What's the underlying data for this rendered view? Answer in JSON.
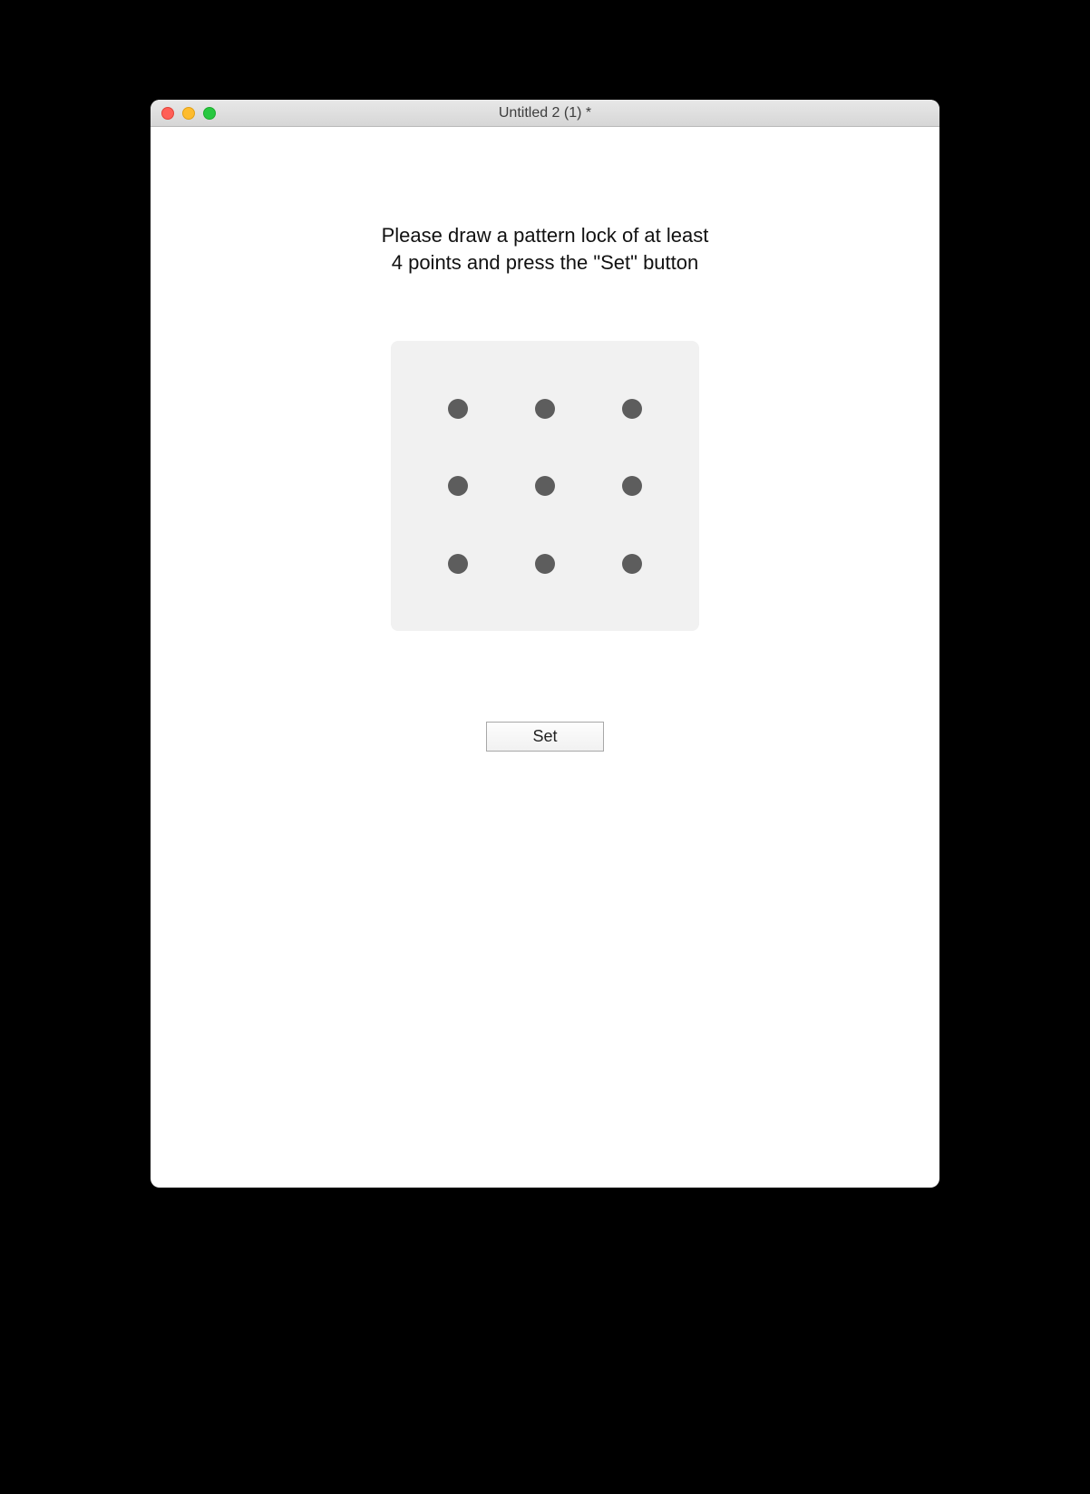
{
  "window": {
    "title": "Untitled 2 (1) *"
  },
  "main": {
    "instruction_line1": "Please draw a pattern lock of at least",
    "instruction_line2": "4 points and press the \"Set\" button",
    "set_button_label": "Set"
  }
}
